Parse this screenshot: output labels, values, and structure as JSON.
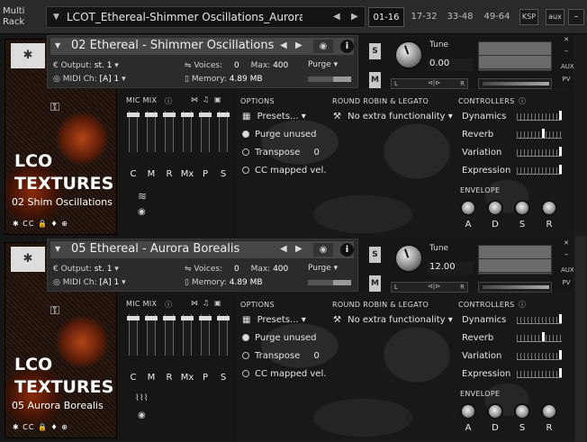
{
  "rack": {
    "title_line1": "Multi",
    "title_line2": "Rack",
    "name": "LCOT_Ethereal-Shimmer Oscillations_Aurora Bore",
    "pages": [
      "01-16",
      "17-32",
      "33-48",
      "49-64"
    ],
    "ksp": "KSP",
    "aux": "aux"
  },
  "labels": {
    "output": "Output:",
    "voices": "Voices:",
    "max": "Max:",
    "midi": "MIDI Ch:",
    "memory": "Memory:",
    "purge": "Purge",
    "tune": "Tune",
    "s": "S",
    "m": "M",
    "l": "L",
    "r": "R",
    "aux": "AUX",
    "pv": "PV",
    "mic_mix": "MIC MIX",
    "options": "OPTIONS",
    "round_robin": "ROUND ROBIN & LEGATO",
    "controllers": "CONTROLLERS",
    "envelope": "ENVELOPE",
    "presets": "Presets...",
    "no_func": "No extra functionality",
    "purge_unused": "Purge unused",
    "transpose": "Transpose",
    "cc_mapped": "CC mapped vel.",
    "ctrl_names": [
      "Dynamics",
      "Reverb",
      "Variation",
      "Expression"
    ],
    "env_names": [
      "A",
      "D",
      "S",
      "R"
    ],
    "mic_names": [
      "C",
      "M",
      "R",
      "Mx",
      "P",
      "S"
    ],
    "lco": "LCO",
    "textures": "TEXTURES",
    "cc": "CC"
  },
  "instruments": [
    {
      "name": "02 Ethereal - Shimmer Oscillations",
      "output": "st. 1",
      "voices": "0",
      "max": "400",
      "midi": "[A]  1",
      "memory": "4.89 MB",
      "tune": "0.00",
      "art_sub": "02 Shim Oscillations",
      "transpose": "0"
    },
    {
      "name": "05 Ethereal - Aurora Borealis",
      "output": "st. 1",
      "voices": "0",
      "max": "400",
      "midi": "[A]  1",
      "memory": "4.89 MB",
      "tune": "12.00",
      "art_sub": "05 Aurora Borealis",
      "transpose": "0"
    }
  ]
}
